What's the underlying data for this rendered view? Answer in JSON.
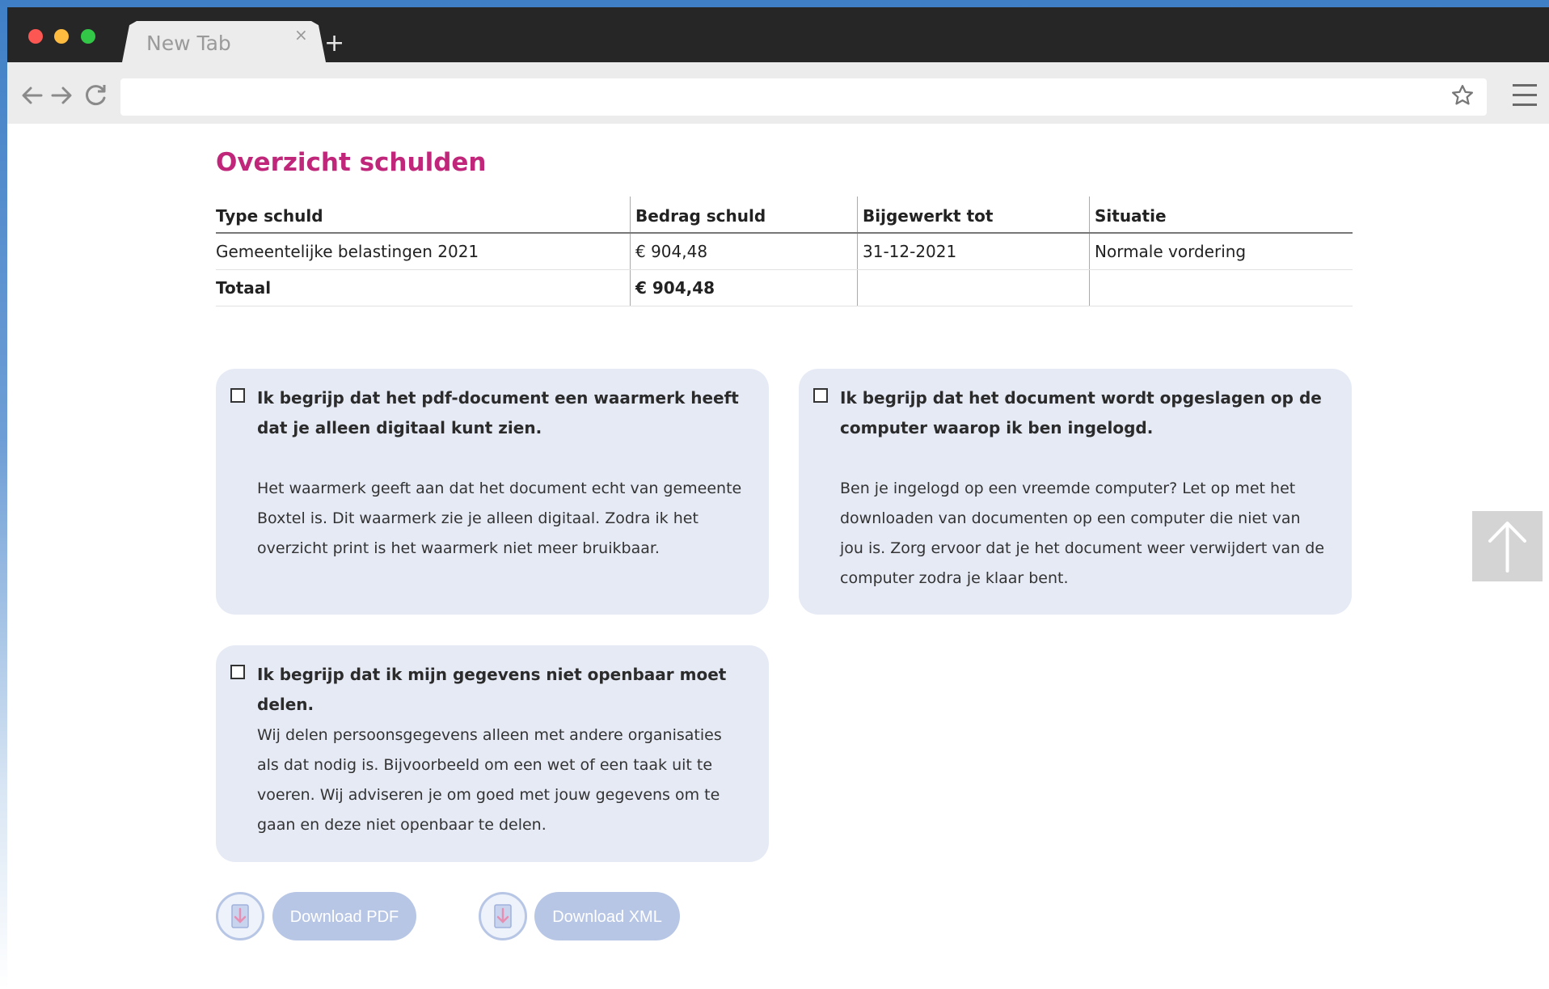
{
  "browser": {
    "tab_title": "New Tab",
    "tab_close": "×",
    "new_tab": "+"
  },
  "page": {
    "title": "Overzicht schulden",
    "table": {
      "headers": [
        "Type schuld",
        "Bedrag schuld",
        "Bijgewerkt tot",
        "Situatie"
      ],
      "rows": [
        [
          "Gemeentelijke belastingen 2021",
          "€ 904,48",
          "31-12-2021",
          "Normale vordering"
        ]
      ],
      "total": [
        "Totaal",
        "€ 904,48",
        "",
        ""
      ]
    },
    "cards": [
      {
        "heading": "Ik begrijp dat het pdf-document een waarmerk heeft dat je alleen digitaal kunt zien.",
        "body": "Het waarmerk geeft aan dat het document echt van gemeente Boxtel is. Dit waarmerk zie je alleen digitaal. Zodra ik het overzicht print is het waarmerk niet meer bruikbaar.",
        "checked": false
      },
      {
        "heading": "Ik begrijp dat het document wordt opgeslagen op de computer waarop ik ben ingelogd.",
        "body": "Ben je ingelogd op een vreemde computer? Let op met het downloaden van documenten op een computer die niet van jou is. Zorg ervoor dat je het document weer verwijdert van de computer zodra je klaar bent.",
        "checked": false
      },
      {
        "heading": "Ik begrijp dat ik mijn gegevens niet openbaar moet delen.",
        "body": "Wij delen persoonsgegevens alleen met andere organisaties als dat nodig is. Bijvoorbeeld om een wet of een taak uit te voeren. Wij adviseren je om goed met jouw gegevens om te gaan en deze niet openbaar te delen.",
        "checked": false
      }
    ],
    "downloads": {
      "pdf_label": "Download PDF",
      "xml_label": "Download XML",
      "icon": "download-document-icon"
    },
    "scroll_top_icon": "arrow-up-icon"
  },
  "colors": {
    "title": "#c0267a",
    "card_bg": "#e5eaf5",
    "button_disabled": "#b8c6e6"
  }
}
